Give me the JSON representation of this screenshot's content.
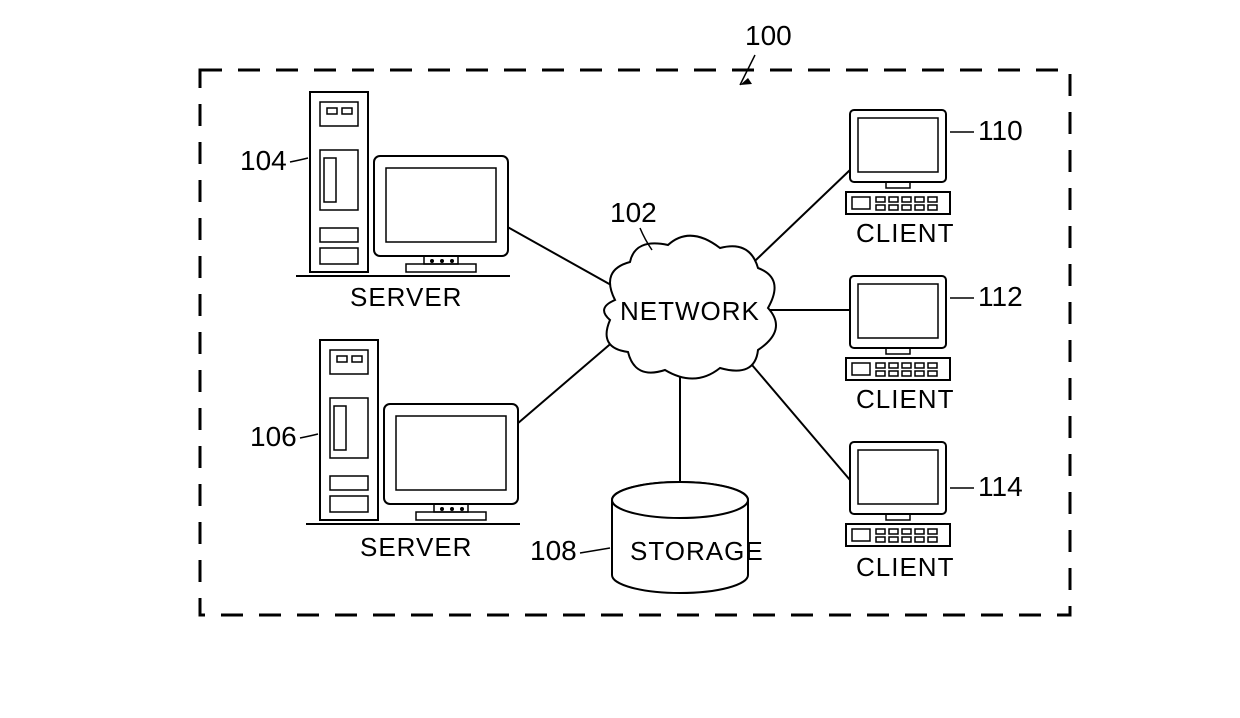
{
  "diagram": {
    "figure_ref": "100",
    "network": {
      "ref": "102",
      "label": "NETWORK"
    },
    "storage": {
      "ref": "108",
      "label": "STORAGE"
    },
    "servers": [
      {
        "ref": "104",
        "label": "SERVER"
      },
      {
        "ref": "106",
        "label": "SERVER"
      }
    ],
    "clients": [
      {
        "ref": "110",
        "label": "CLIENT"
      },
      {
        "ref": "112",
        "label": "CLIENT"
      },
      {
        "ref": "114",
        "label": "CLIENT"
      }
    ]
  }
}
